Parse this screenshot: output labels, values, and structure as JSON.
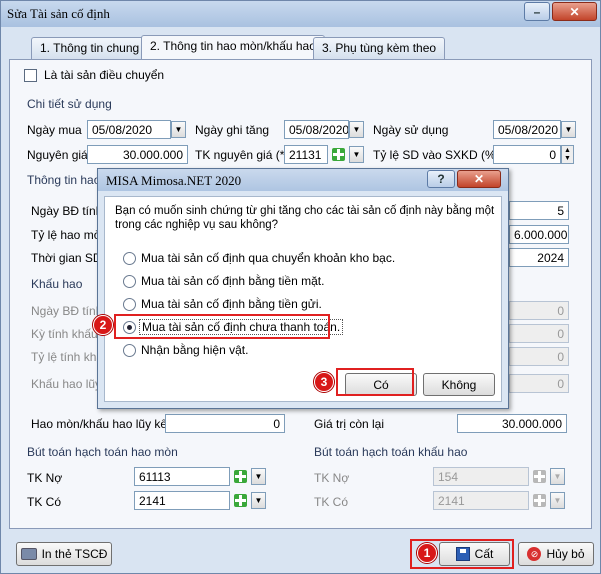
{
  "window": {
    "title": "Sửa Tài sản cố định"
  },
  "tabs": [
    "1. Thông tin chung",
    "2. Thông tin hao mòn/khấu hao",
    "3. Phụ tùng kèm theo"
  ],
  "form": {
    "transfer_checkbox": "Là tài sản điều chuyển",
    "usage_section": "Chi tiết sử dụng",
    "purchase_date_label": "Ngày mua",
    "purchase_date": "05/08/2020",
    "increase_date_label": "Ngày ghi tăng",
    "increase_date": "05/08/2020",
    "use_date_label": "Ngày sử dụng",
    "use_date": "05/08/2020",
    "original_cost_label": "Nguyên giá",
    "original_cost": "30.000.000",
    "tk_cost_label": "TK nguyên giá (*)",
    "tk_cost": "21131",
    "ratio_label": "Tỷ lệ SD vào SXKD (%)",
    "ratio": "0",
    "dep_info_section": "Thông tin hao",
    "start_date_label": "Ngày BĐ tính",
    "years_value": "5",
    "rate_label": "Tỷ lệ hao mòn",
    "rate_value": "6.000.000",
    "time_label": "Thời gian SD",
    "year_value": "2024",
    "khau_hao_section": "Khấu hao",
    "kh_start_label": "Ngày BĐ tính",
    "kh_period_label": "Kỳ tính khấu",
    "kh_rate_label": "Tỷ lệ tính khấ",
    "kh_accum_label": "Khấu hao lũy",
    "kh_zero_1": "0",
    "kh_zero_2": "0",
    "kh_zero_3": "0",
    "kh_zero_4": "0",
    "accum_label": "Hao mòn/khấu hao lũy kế",
    "accum_value": "0",
    "remaining_label": "Giá trị còn lại",
    "remaining_value": "30.000.000",
    "hm_section": "Bút toán hạch toán hao mòn",
    "kh_entry_section": "Bút toán hạch toán khấu hao",
    "tk_no_label": "TK Nợ",
    "tk_co_label": "TK Có",
    "hm_tk_no": "61113",
    "hm_tk_co": "2141",
    "kh_tk_no": "154",
    "kh_tk_co": "2141"
  },
  "footer": {
    "print_button": "In thẻ TSCĐ",
    "save_button": "Cất",
    "cancel_button": "Hủy bỏ"
  },
  "dialog": {
    "title": "MISA Mimosa.NET 2020",
    "question_line1": "Bạn có muốn sinh chứng từ ghi tăng cho các tài sản cố định này bằng một",
    "question_line2": "trong các nghiệp vụ sau không?",
    "options": [
      "Mua tài sản cố định qua chuyển khoản kho bạc.",
      "Mua tài sản cố định bằng tiền mặt.",
      "Mua tài sản cố định bằng tiền gửi.",
      "Mua tài sản cố định chưa thanh toán.",
      "Nhận bằng hiện vật."
    ],
    "selected_index": 3,
    "yes_button": "Có",
    "no_button": "Không"
  },
  "annotations": [
    "1",
    "2",
    "3"
  ],
  "colors": {
    "highlight": "#e02020",
    "badge": "#d81818"
  }
}
